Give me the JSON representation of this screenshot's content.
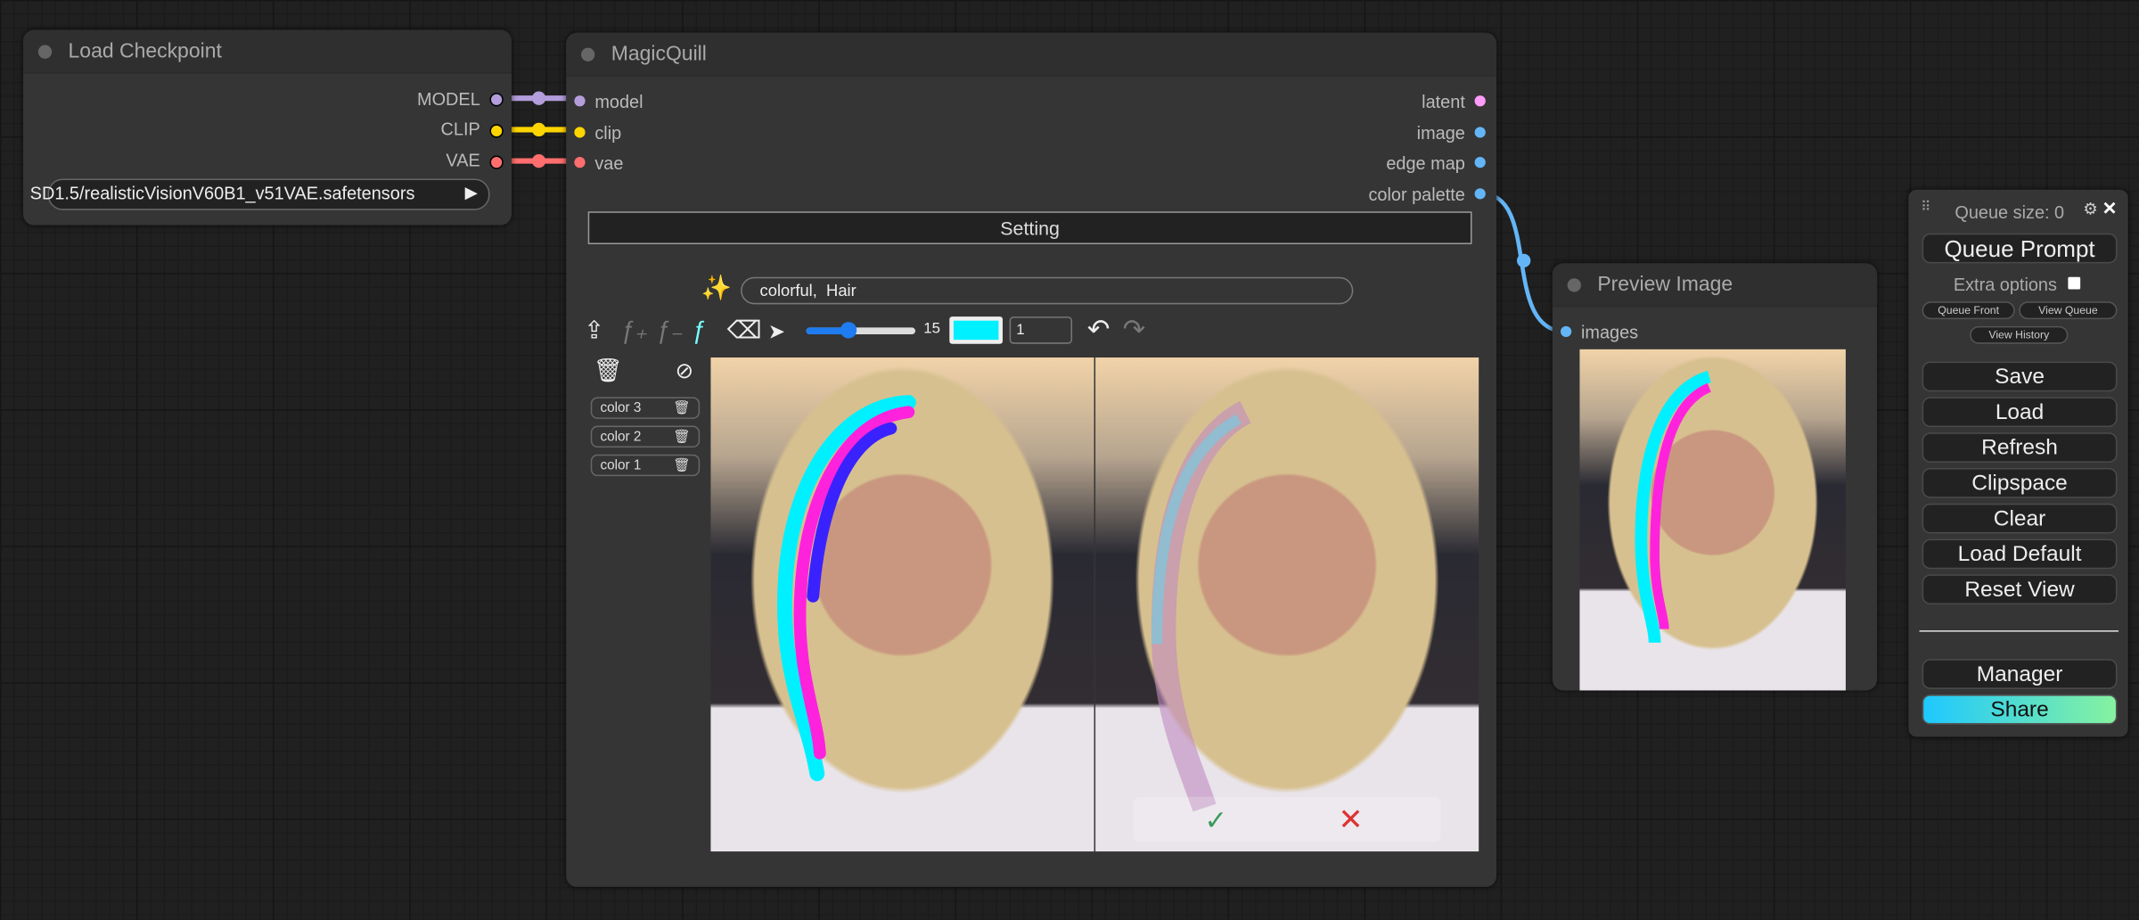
{
  "load_checkpoint": {
    "title": "Load Checkpoint",
    "outputs": [
      "MODEL",
      "CLIP",
      "VAE"
    ],
    "ckpt_name": "SD1.5/realisticVisionV60B1_v51VAE.safetensors"
  },
  "magicquill": {
    "title": "MagicQuill",
    "inputs": [
      "model",
      "clip",
      "vae"
    ],
    "outputs": [
      "latent",
      "image",
      "edge map",
      "color palette"
    ],
    "setting_label": "Setting",
    "prompt": "colorful,  Hair",
    "brush_size": "15",
    "brush_color": "#00f0ff",
    "opacity_value": "1",
    "color_chips": [
      "color 3",
      "color 2",
      "color 1"
    ]
  },
  "preview_image": {
    "title": "Preview Image",
    "input": "images"
  },
  "menu": {
    "queue_size": "Queue size: 0",
    "queue_prompt": "Queue Prompt",
    "extra_options": "Extra options",
    "queue_front": "Queue Front",
    "view_queue": "View Queue",
    "view_history": "View History",
    "buttons": [
      "Save",
      "Load",
      "Refresh",
      "Clipspace",
      "Clear",
      "Load Default",
      "Reset View"
    ],
    "manager": "Manager",
    "share": "Share"
  },
  "colors": {
    "model": "#b39ddb",
    "clip": "#ffd500",
    "vae": "#ff6e6e",
    "latent": "#ff9cf9",
    "image": "#64b5f6"
  }
}
